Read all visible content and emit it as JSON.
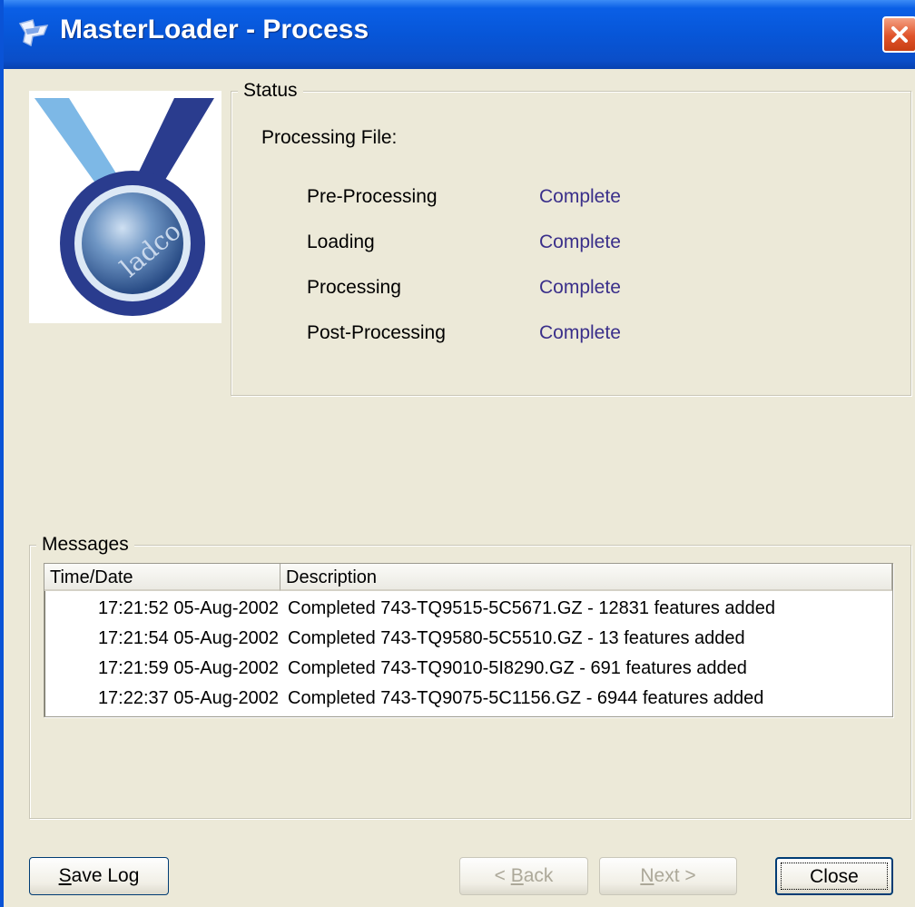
{
  "window": {
    "title": "MasterLoader - Process"
  },
  "status": {
    "legend": "Status",
    "processing_file_label": "Processing File:",
    "stages": [
      {
        "name": "Pre-Processing",
        "value": "Complete"
      },
      {
        "name": "Loading",
        "value": "Complete"
      },
      {
        "name": "Processing",
        "value": "Complete"
      },
      {
        "name": "Post-Processing",
        "value": "Complete"
      }
    ]
  },
  "logo": {
    "text": "ladco"
  },
  "messages": {
    "legend": "Messages",
    "columns": [
      "Time/Date",
      "Description"
    ],
    "rows": [
      {
        "time": "17:21:52 05-Aug-2002",
        "description": "Completed 743-TQ9515-5C5671.GZ - 12831 features added"
      },
      {
        "time": "17:21:54 05-Aug-2002",
        "description": "Completed 743-TQ9580-5C5510.GZ - 13 features added"
      },
      {
        "time": "17:21:59 05-Aug-2002",
        "description": "Completed 743-TQ9010-5I8290.GZ - 691 features added"
      },
      {
        "time": "17:22:37 05-Aug-2002",
        "description": "Completed 743-TQ9075-5C1156.GZ - 6944 features added"
      }
    ]
  },
  "buttons": {
    "save_log": {
      "underline": "S",
      "rest": "ave Log"
    },
    "back": {
      "prefix": "< ",
      "underline": "B",
      "rest": "ack"
    },
    "next": {
      "underline": "N",
      "rest": "ext >"
    },
    "close": "Close"
  },
  "colors": {
    "titlebar": "#0756d8",
    "dialog_bg": "#ece9d8",
    "status_value": "#3a2f8a",
    "close_button": "#e0532a"
  }
}
